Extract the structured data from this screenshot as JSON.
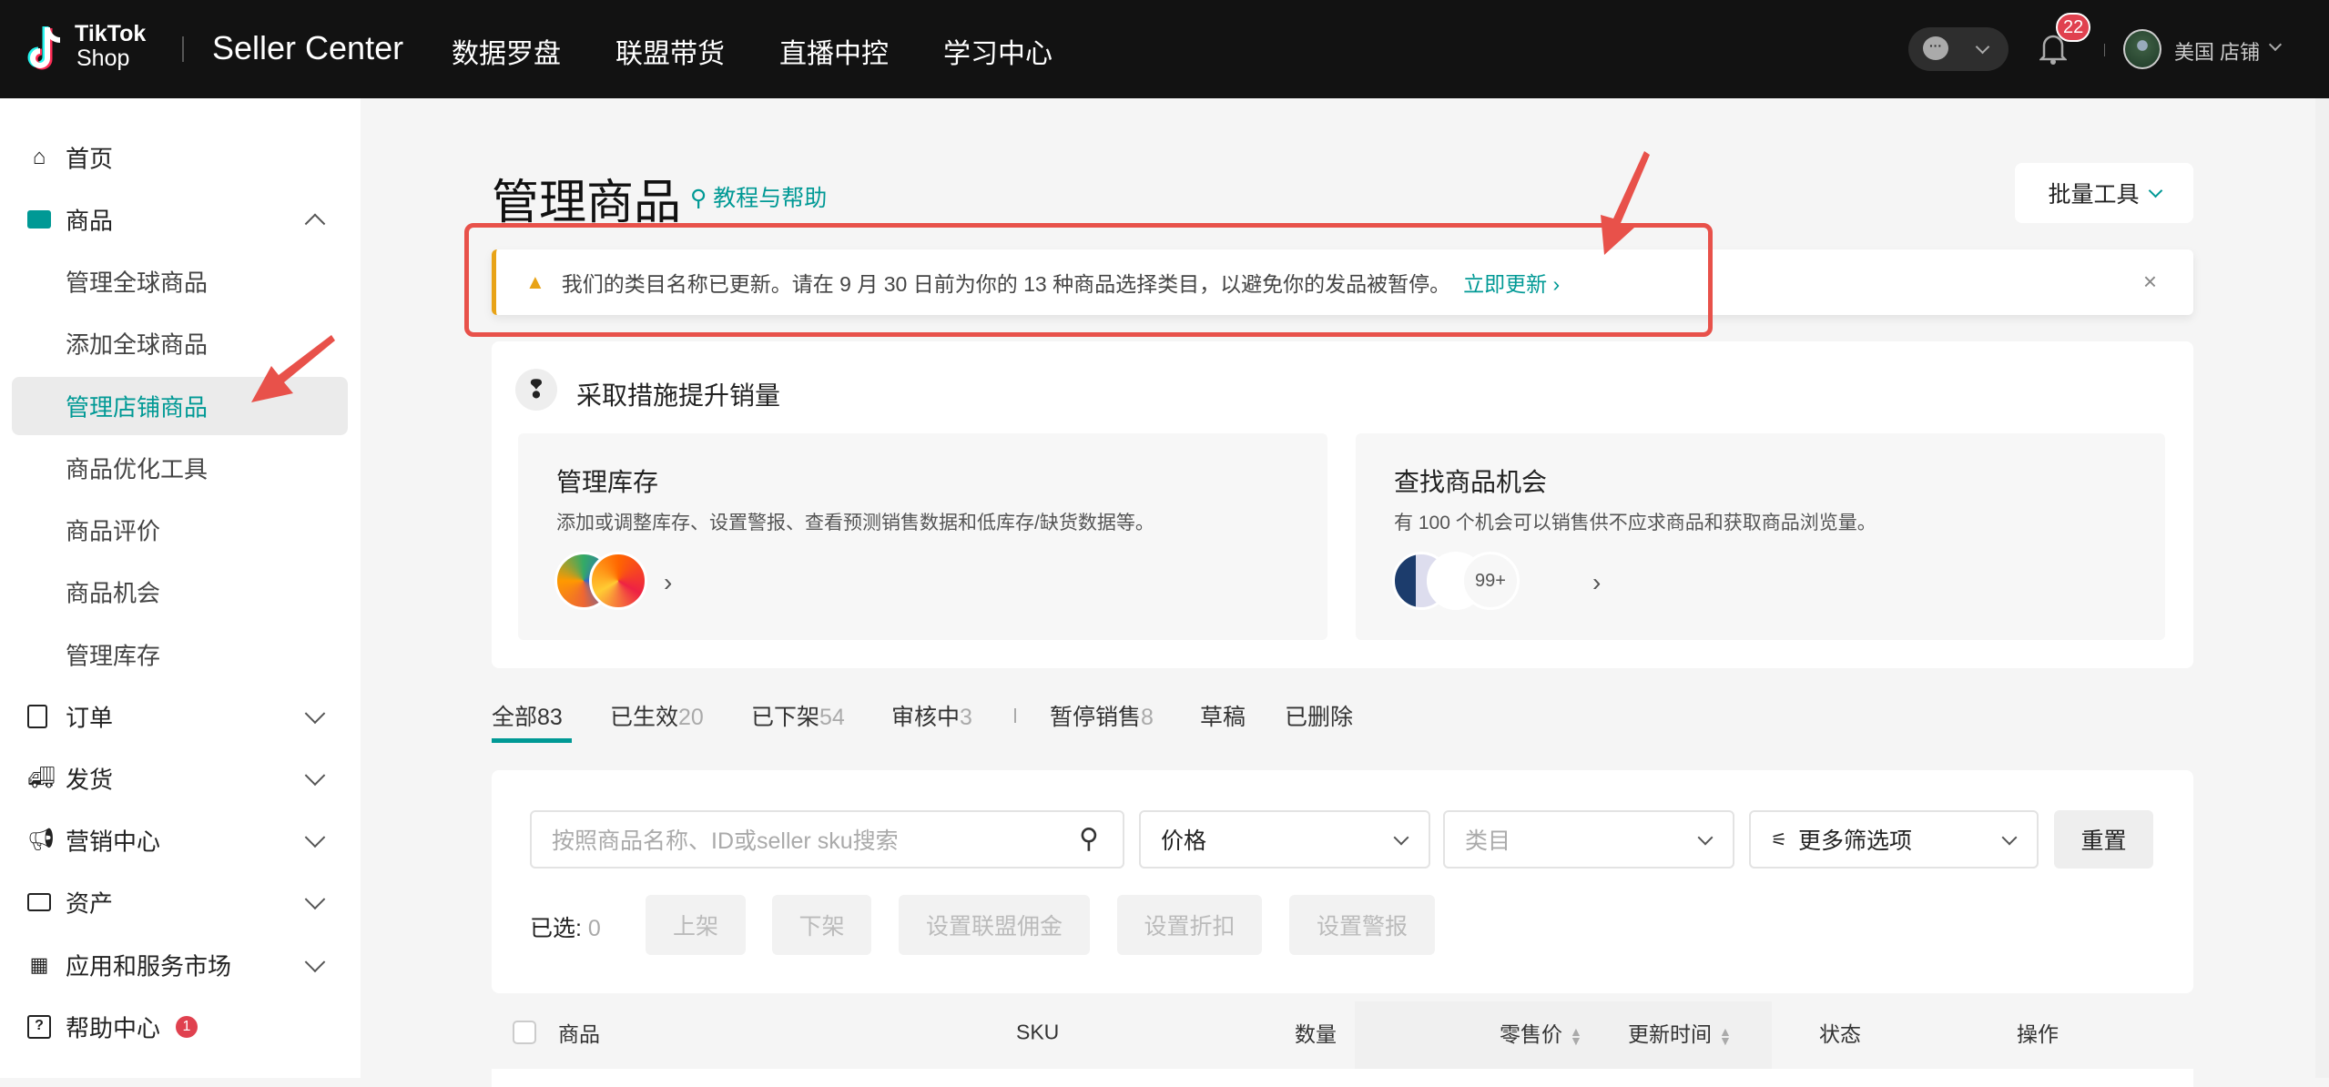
{
  "header": {
    "logo_line1": "TikTok",
    "logo_line2": "Shop",
    "app_title": "Seller Center",
    "nav": [
      "数据罗盘",
      "联盟带货",
      "直播中控",
      "学习中心"
    ],
    "notification_count": "22",
    "store_name": "美国 店铺"
  },
  "sidebar": {
    "items": [
      {
        "label": "首页",
        "icon": "home-icon"
      },
      {
        "label": "商品",
        "icon": "shopping-bag-icon",
        "expanded": true,
        "children": [
          "管理全球商品",
          "添加全球商品",
          "管理店铺商品",
          "商品优化工具",
          "商品评价",
          "商品机会",
          "管理库存"
        ],
        "active_child": "管理店铺商品"
      },
      {
        "label": "订单",
        "icon": "clipboard-icon"
      },
      {
        "label": "发货",
        "icon": "truck-icon"
      },
      {
        "label": "营销中心",
        "icon": "megaphone-icon"
      },
      {
        "label": "资产",
        "icon": "wallet-icon"
      },
      {
        "label": "应用和服务市场",
        "icon": "apps-grid-icon"
      },
      {
        "label": "帮助中心",
        "icon": "help-icon",
        "badge": "1"
      }
    ]
  },
  "page": {
    "title": "管理商品",
    "help_link": "教程与帮助",
    "bulk_tools": "批量工具"
  },
  "alert": {
    "text": "我们的类目名称已更新。请在 9 月 30 日前为你的 13 种商品选择类目，以避免你的发品被暂停。",
    "link": "立即更新"
  },
  "sales": {
    "title": "采取措施提升销量",
    "cards": [
      {
        "title": "管理库存",
        "desc": "添加或调整库存、设置警报、查看预测销售数据和低库存/缺货数据等。"
      },
      {
        "title": "查找商品机会",
        "desc": "有 100 个机会可以销售供不应求商品和获取商品浏览量。",
        "more": "99+"
      }
    ]
  },
  "tabs": [
    {
      "label": "全部",
      "count": "83",
      "active": true
    },
    {
      "label": "已生效",
      "count": "20"
    },
    {
      "label": "已下架",
      "count": "54"
    },
    {
      "label": "审核中",
      "count": "3"
    },
    {
      "label": "暂停销售",
      "count": "8"
    },
    {
      "label": "草稿",
      "count": ""
    },
    {
      "label": "已删除",
      "count": ""
    }
  ],
  "filters": {
    "search_placeholder": "按照商品名称、ID或seller sku搜索",
    "price": "价格",
    "category_placeholder": "类目",
    "more": "更多筛选项",
    "reset": "重置"
  },
  "bulk": {
    "selected_label": "已选:",
    "selected_count": "0",
    "buttons": [
      "上架",
      "下架",
      "设置联盟佣金",
      "设置折扣",
      "设置警报"
    ]
  },
  "table": {
    "columns": [
      "商品",
      "SKU",
      "数量",
      "零售价",
      "更新时间",
      "状态",
      "操作"
    ]
  },
  "colors": {
    "accent": "#009995",
    "header_bg": "#121212",
    "annotation": "#e8514a",
    "warning": "#e8a317"
  }
}
